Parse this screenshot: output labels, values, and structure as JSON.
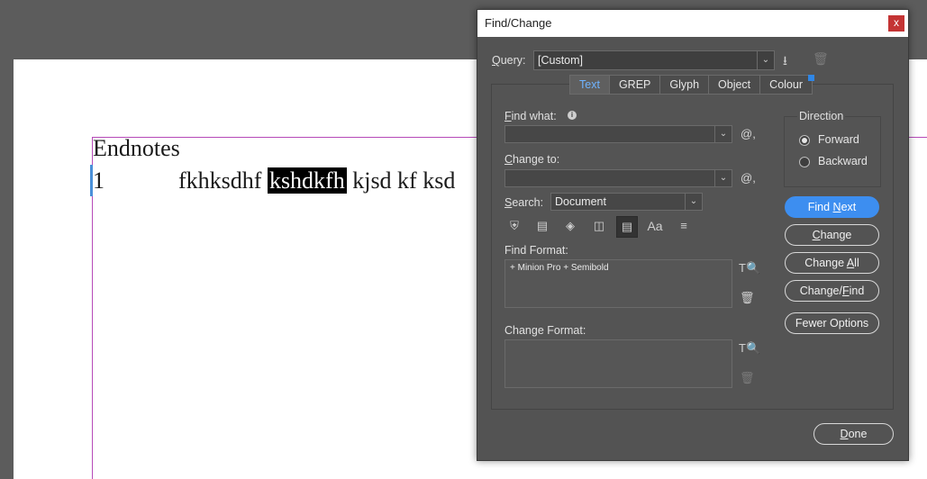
{
  "document": {
    "heading": "Endnotes",
    "line_number": "1",
    "text_before": "fkhksdhf ",
    "text_selected": "kshdkfh",
    "text_after": " kjsd kf ksd"
  },
  "dialog": {
    "title": "Find/Change",
    "close_label": "x",
    "query_label": "Query:",
    "query_value": "[Custom]",
    "tabs": [
      {
        "label": "Text",
        "active": true
      },
      {
        "label": "GREP",
        "active": false
      },
      {
        "label": "Glyph",
        "active": false
      },
      {
        "label": "Object",
        "active": false
      },
      {
        "label": "Colour",
        "active": false
      }
    ],
    "find_what_label": "Find what:",
    "find_what_value": "",
    "change_to_label": "Change to:",
    "change_to_value": "",
    "search_label": "Search:",
    "search_value": "Document",
    "find_format_label": "Find Format:",
    "find_format_value": "+ Minion Pro + Semibold",
    "change_format_label": "Change Format:",
    "change_format_value": "",
    "direction": {
      "legend": "Direction",
      "options": [
        {
          "label": "Forward",
          "selected": true
        },
        {
          "label": "Backward",
          "selected": false
        }
      ]
    },
    "buttons": {
      "find_next": "Find Next",
      "change": "Change",
      "change_all": "Change All",
      "change_find": "Change/Find",
      "fewer_options": "Fewer Options",
      "done": "Done"
    },
    "icons": {
      "save_query": "save-icon",
      "delete_query": "trash-icon",
      "special_chars": "at-sign-icon",
      "specify_format": "format-search-icon",
      "clear_format": "trash-icon"
    },
    "colors": {
      "accent": "#3d8ef0",
      "active_tab_text": "#6fb3ff",
      "dialog_bg": "#535353",
      "close_button": "#c43434",
      "guide": "#b64ab8"
    }
  }
}
